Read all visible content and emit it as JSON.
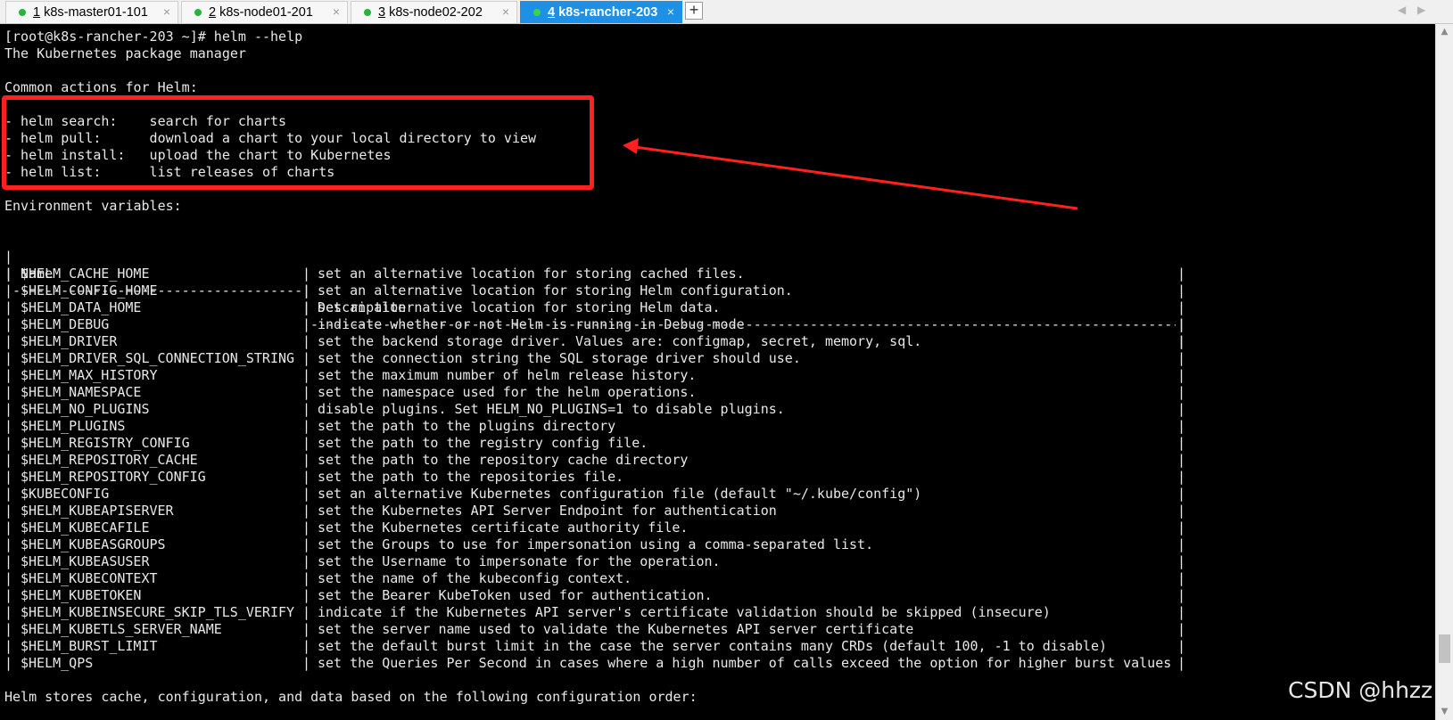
{
  "tabs": [
    {
      "number": "1",
      "label": "k8s-master01-101",
      "active": false
    },
    {
      "number": "2",
      "label": "k8s-node01-201",
      "active": false
    },
    {
      "number": "3",
      "label": "k8s-node02-202",
      "active": false
    },
    {
      "number": "4",
      "label": "k8s-rancher-203",
      "active": true
    }
  ],
  "tab_close_glyph": "×",
  "new_tab_glyph": "+",
  "nav": {
    "prev_glyph": "◀",
    "next_glyph": "▶"
  },
  "terminal": {
    "prompt_line": "[root@k8s-rancher-203 ~]# helm --help",
    "tagline": "The Kubernetes package manager",
    "common_header": "Common actions for Helm:",
    "common_actions": [
      "- helm search:    search for charts",
      "- helm pull:      download a chart to your local directory to view",
      "- helm install:   upload the chart to Kubernetes",
      "- helm list:      list releases of charts"
    ],
    "env_header": "Environment variables:",
    "table": {
      "headers": {
        "name": "Name",
        "description": "Description"
      },
      "rows": [
        {
          "name": "$HELM_CACHE_HOME",
          "description": "set an alternative location for storing cached files."
        },
        {
          "name": "$HELM_CONFIG_HOME",
          "description": "set an alternative location for storing Helm configuration."
        },
        {
          "name": "$HELM_DATA_HOME",
          "description": "set an alternative location for storing Helm data."
        },
        {
          "name": "$HELM_DEBUG",
          "description": "indicate whether or not Helm is running in Debug mode"
        },
        {
          "name": "$HELM_DRIVER",
          "description": "set the backend storage driver. Values are: configmap, secret, memory, sql."
        },
        {
          "name": "$HELM_DRIVER_SQL_CONNECTION_STRING",
          "description": "set the connection string the SQL storage driver should use."
        },
        {
          "name": "$HELM_MAX_HISTORY",
          "description": "set the maximum number of helm release history."
        },
        {
          "name": "$HELM_NAMESPACE",
          "description": "set the namespace used for the helm operations."
        },
        {
          "name": "$HELM_NO_PLUGINS",
          "description": "disable plugins. Set HELM_NO_PLUGINS=1 to disable plugins."
        },
        {
          "name": "$HELM_PLUGINS",
          "description": "set the path to the plugins directory"
        },
        {
          "name": "$HELM_REGISTRY_CONFIG",
          "description": "set the path to the registry config file."
        },
        {
          "name": "$HELM_REPOSITORY_CACHE",
          "description": "set the path to the repository cache directory"
        },
        {
          "name": "$HELM_REPOSITORY_CONFIG",
          "description": "set the path to the repositories file."
        },
        {
          "name": "$KUBECONFIG",
          "description": "set an alternative Kubernetes configuration file (default \"~/.kube/config\")"
        },
        {
          "name": "$HELM_KUBEAPISERVER",
          "description": "set the Kubernetes API Server Endpoint for authentication"
        },
        {
          "name": "$HELM_KUBECAFILE",
          "description": "set the Kubernetes certificate authority file."
        },
        {
          "name": "$HELM_KUBEASGROUPS",
          "description": "set the Groups to use for impersonation using a comma-separated list."
        },
        {
          "name": "$HELM_KUBEASUSER",
          "description": "set the Username to impersonate for the operation."
        },
        {
          "name": "$HELM_KUBECONTEXT",
          "description": "set the name of the kubeconfig context."
        },
        {
          "name": "$HELM_KUBETOKEN",
          "description": "set the Bearer KubeToken used for authentication."
        },
        {
          "name": "$HELM_KUBEINSECURE_SKIP_TLS_VERIFY",
          "description": "indicate if the Kubernetes API server's certificate validation should be skipped (insecure)"
        },
        {
          "name": "$HELM_KUBETLS_SERVER_NAME",
          "description": "set the server name used to validate the Kubernetes API server certificate"
        },
        {
          "name": "$HELM_BURST_LIMIT",
          "description": "set the default burst limit in the case the server contains many CRDs (default 100, -1 to disable)"
        },
        {
          "name": "$HELM_QPS",
          "description": "set the Queries Per Second in cases where a high number of calls exceed the option for higher burst values"
        }
      ]
    },
    "footer_line": "Helm stores cache, configuration, and data based on the following configuration order:"
  },
  "scrollbar": {
    "up_glyph": "▲",
    "down_glyph": "▼"
  },
  "watermark": "CSDN @hhzz",
  "annotation_color": "#ff2020",
  "active_tab_color": "#1e90e6",
  "status_dot_color": "#27b43e"
}
